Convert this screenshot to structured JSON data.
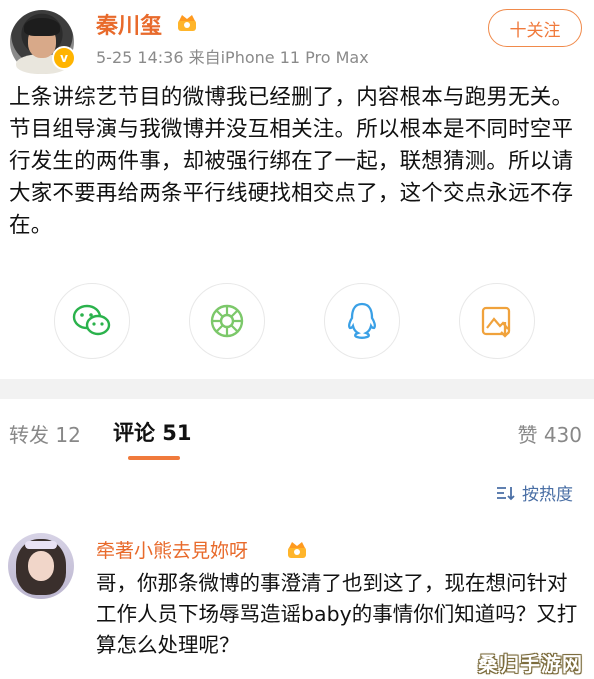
{
  "post": {
    "author": "秦川玺",
    "meta": "5-25 14:36  来自iPhone 11 Pro Max",
    "follow_label": "十关注",
    "text": "上条讲综艺节目的微博我已经删了，内容根本与跑男无关。节目组导演与我微博并没互相关注。所以根本是不同时空平行发生的两件事，却被强行绑在了一起，联想猜测。所以请大家不要再给两条平行线硬找相交点了，这个交点永远不存在。",
    "verified_badge": "v"
  },
  "share": {
    "icons": [
      "wechat-icon",
      "moments-icon",
      "qq-icon",
      "save-image-icon"
    ],
    "colors": {
      "green": "#2bb24c",
      "lime": "#7cc86a",
      "blue": "#3aa0e6",
      "orange": "#f0a23c"
    }
  },
  "tabs": {
    "repost": "转发 12",
    "comment": "评论 51",
    "like": "赞 430"
  },
  "sort": {
    "label": "按热度"
  },
  "comment": {
    "author": "牵著小熊去見妳呀",
    "text": "哥，你那条微博的事澄清了也到这了，现在想问针对工作人员下场辱骂造谣baby的事情你们知道吗？又打算怎么处理呢？"
  },
  "watermark": "桑归手游网",
  "colors": {
    "accent": "#f07a3c",
    "name": "#e86a2b",
    "link": "#4a6fa5"
  }
}
